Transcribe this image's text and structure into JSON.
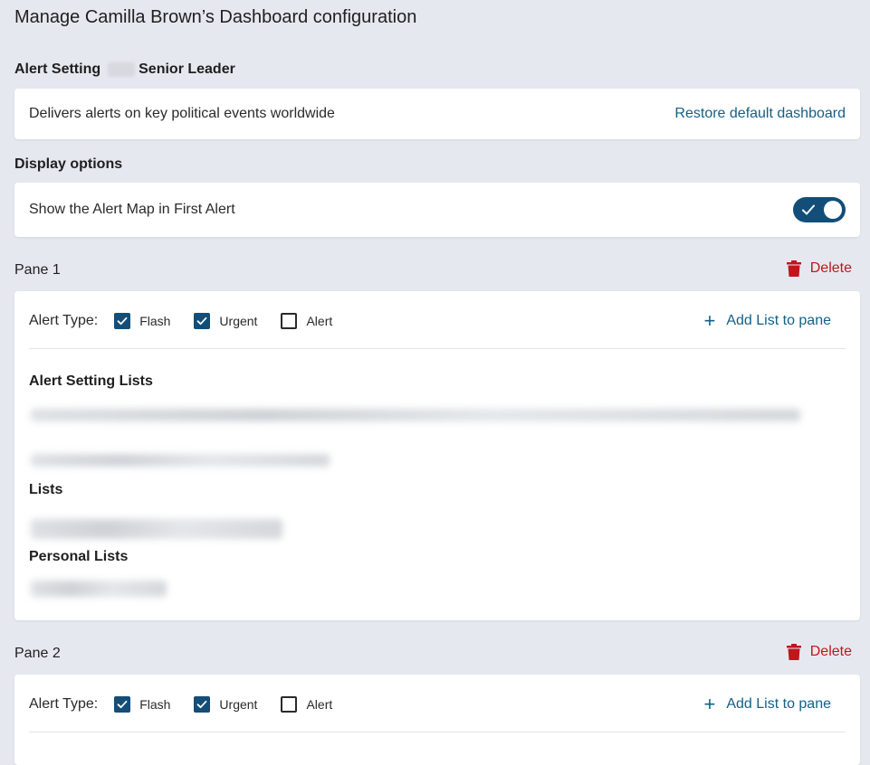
{
  "page": {
    "title": "Manage Camilla Brown’s Dashboard configuration"
  },
  "alert_setting": {
    "heading": "Alert Setting",
    "role": "Senior Leader",
    "description": "Delivers alerts on key political events worldwide",
    "restore_label": "Restore default dashboard"
  },
  "display_options": {
    "heading": "Display options",
    "map_toggle_label": "Show the Alert Map in First Alert",
    "map_toggle_on": true
  },
  "panes": [
    {
      "title": "Pane  1",
      "delete_label": "Delete",
      "alert_type_label": "Alert Type:",
      "alert_types": [
        {
          "label": "Flash",
          "checked": true
        },
        {
          "label": "Urgent",
          "checked": true
        },
        {
          "label": "Alert",
          "checked": false
        }
      ],
      "add_list_label": "Add List to pane",
      "alert_setting_lists_heading": "Alert Setting Lists",
      "lists_heading": "Lists",
      "personal_lists_heading": "Personal Lists"
    },
    {
      "title": "Pane  2",
      "delete_label": "Delete",
      "alert_type_label": "Alert Type:",
      "alert_types": [
        {
          "label": "Flash",
          "checked": true
        },
        {
          "label": "Urgent",
          "checked": true
        },
        {
          "label": "Alert",
          "checked": false
        }
      ],
      "add_list_label": "Add List to pane"
    }
  ],
  "icons": {
    "toggle_check": "check-icon",
    "delete": "trash-icon",
    "add": "plus-icon",
    "checkbox_on": "checkmark-icon"
  },
  "colors": {
    "accent": "#124e78",
    "link": "#135f86",
    "danger": "#c0161c",
    "background": "#e6e8f0"
  }
}
